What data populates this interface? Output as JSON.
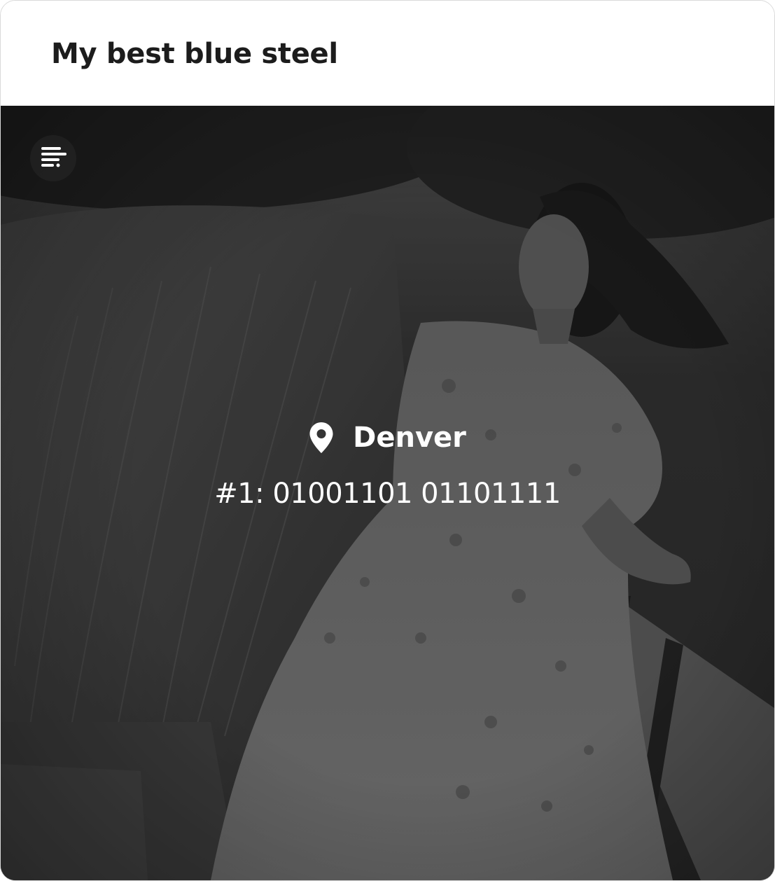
{
  "card": {
    "title": "My best blue steel"
  },
  "photo": {
    "menu_icon": "sort-lines-icon",
    "location_icon": "map-pin-icon",
    "location": "Denver",
    "rank_text": "#1: 01001101 01101111"
  }
}
